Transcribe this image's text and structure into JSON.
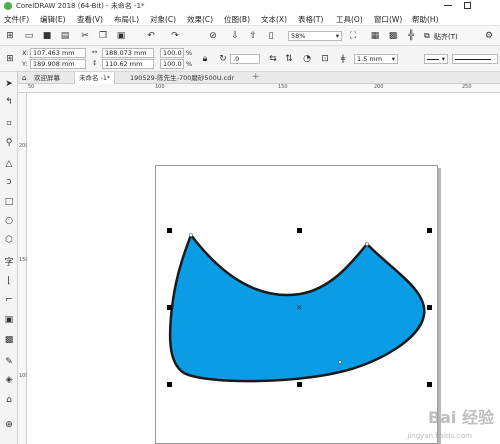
{
  "title": "CorelDRAW 2018 (64-Bit) - 未命名 -1*",
  "menu": [
    "文件(F)",
    "编辑(E)",
    "查看(V)",
    "布局(L)",
    "对象(C)",
    "效果(C)",
    "位图(B)",
    "文本(X)",
    "表格(T)",
    "工具(O)",
    "窗口(W)",
    "帮助(H)"
  ],
  "toolbar": {
    "zoom": "58%",
    "snap_label": "贴齐(T)"
  },
  "props": {
    "x": "107.463 mm",
    "y": "189.908 mm",
    "width": "188.073 mm",
    "height": "110.62 mm",
    "scale_x": "100.0",
    "scale_y": "100.0",
    "pct": "%",
    "angle": ".0",
    "outline": "1.5 mm"
  },
  "tabs": [
    "欢迎屏幕",
    "未命名 -1*",
    "190529-陈先生-700磨砂500U.cdr"
  ],
  "ruler_h": [
    "50",
    "100",
    "150",
    "200",
    "250"
  ],
  "ruler_v": [
    "200",
    "150",
    "100"
  ],
  "shape": {
    "fill": "#0a9de6",
    "outline": "#1a1a1a"
  },
  "watermark": {
    "main": "Bai 经验",
    "sub": "jingyan.baidu.com"
  }
}
